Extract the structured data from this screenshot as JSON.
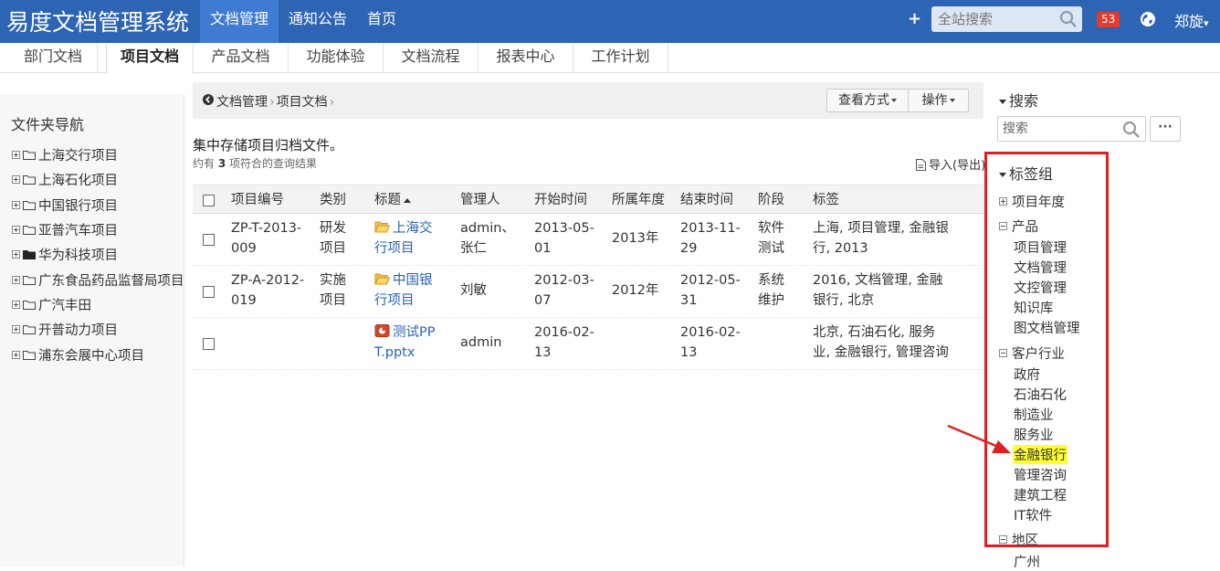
{
  "header": {
    "brand": "易度文档管理系统",
    "nav": [
      "文档管理",
      "通知公告",
      "首页"
    ],
    "search_placeholder": "全站搜索",
    "notification_count": "53",
    "user": "郑旋"
  },
  "subtabs": [
    "部门文档",
    "项目文档",
    "产品文档",
    "功能体验",
    "文档流程",
    "报表中心",
    "工作计划"
  ],
  "sidebar": {
    "title": "文件夹导航",
    "folders": [
      "上海交行项目",
      "上海石化项目",
      "中国银行项目",
      "亚普汽车项目",
      "华为科技项目",
      "广东食品药品监督局项目",
      "广汽丰田",
      "开普动力项目",
      "浦东会展中心项目"
    ]
  },
  "breadcrumb": [
    "文档管理",
    "项目文档"
  ],
  "toolbar": {
    "view_label": "查看方式",
    "ops_label": "操作"
  },
  "content": {
    "description": "集中存储项目归档文件。",
    "count_prefix": "约有",
    "count": "3",
    "count_suffix": "项符合的查询结果",
    "import_label": "导入(导出)"
  },
  "table": {
    "headers": [
      "项目编号",
      "类别",
      "标题",
      "管理人",
      "开始时间",
      "所属年度",
      "结束时间",
      "阶段",
      "标签"
    ],
    "rows": [
      {
        "code": [
          "ZP-T-2013-",
          "009"
        ],
        "category": [
          "研发",
          "项目"
        ],
        "title": [
          "上海交",
          "行项目"
        ],
        "manager": [
          "admin、",
          "张仁"
        ],
        "start": [
          "2013-05-",
          "01"
        ],
        "year": "2013年",
        "end": [
          "2013-11-",
          "29"
        ],
        "stage": [
          "软件",
          "测试"
        ],
        "tags": [
          "上海, 项目管理, 金融银",
          "行, 2013"
        ]
      },
      {
        "code": [
          "ZP-A-2012-",
          "019"
        ],
        "category": [
          "实施",
          "项目"
        ],
        "title": [
          "中国银",
          "行项目"
        ],
        "manager": [
          "刘敏"
        ],
        "start": [
          "2012-03-",
          "07"
        ],
        "year": "2012年",
        "end": [
          "2012-05-",
          "31"
        ],
        "stage": [
          "系统",
          "维护"
        ],
        "tags": [
          "2016, 文档管理, 金融",
          "银行, 北京"
        ]
      },
      {
        "code": [],
        "category": [],
        "title": [
          "测试PP",
          "T.pptx"
        ],
        "manager": [
          "admin"
        ],
        "start": [
          "2016-02-",
          "13"
        ],
        "year": "",
        "end": [
          "2016-02-",
          "13"
        ],
        "stage": [],
        "tags": [
          "北京, 石油石化, 服务",
          "业, 金融银行, 管理咨询"
        ]
      }
    ]
  },
  "right_panel": {
    "search_title": "搜索",
    "search_placeholder": "搜索",
    "more_label": "···",
    "tag_group_title": "标签组",
    "groups": [
      {
        "name": "项目年度",
        "expanded": false,
        "items": []
      },
      {
        "name": "产品",
        "expanded": true,
        "items": [
          "项目管理",
          "文档管理",
          "文控管理",
          "知识库",
          "图文档管理"
        ]
      },
      {
        "name": "客户行业",
        "expanded": true,
        "items": [
          "政府",
          "石油石化",
          "制造业",
          "服务业",
          "金融银行",
          "管理咨询",
          "建筑工程",
          "IT软件"
        ]
      },
      {
        "name": "地区",
        "expanded": true,
        "items": [
          "广州"
        ]
      }
    ],
    "highlighted_tag": "金融银行"
  },
  "colors": {
    "topbar": "#2d64b3",
    "highlight": "#ffff33",
    "annotation": "#e02020",
    "link": "#2a62b6"
  }
}
